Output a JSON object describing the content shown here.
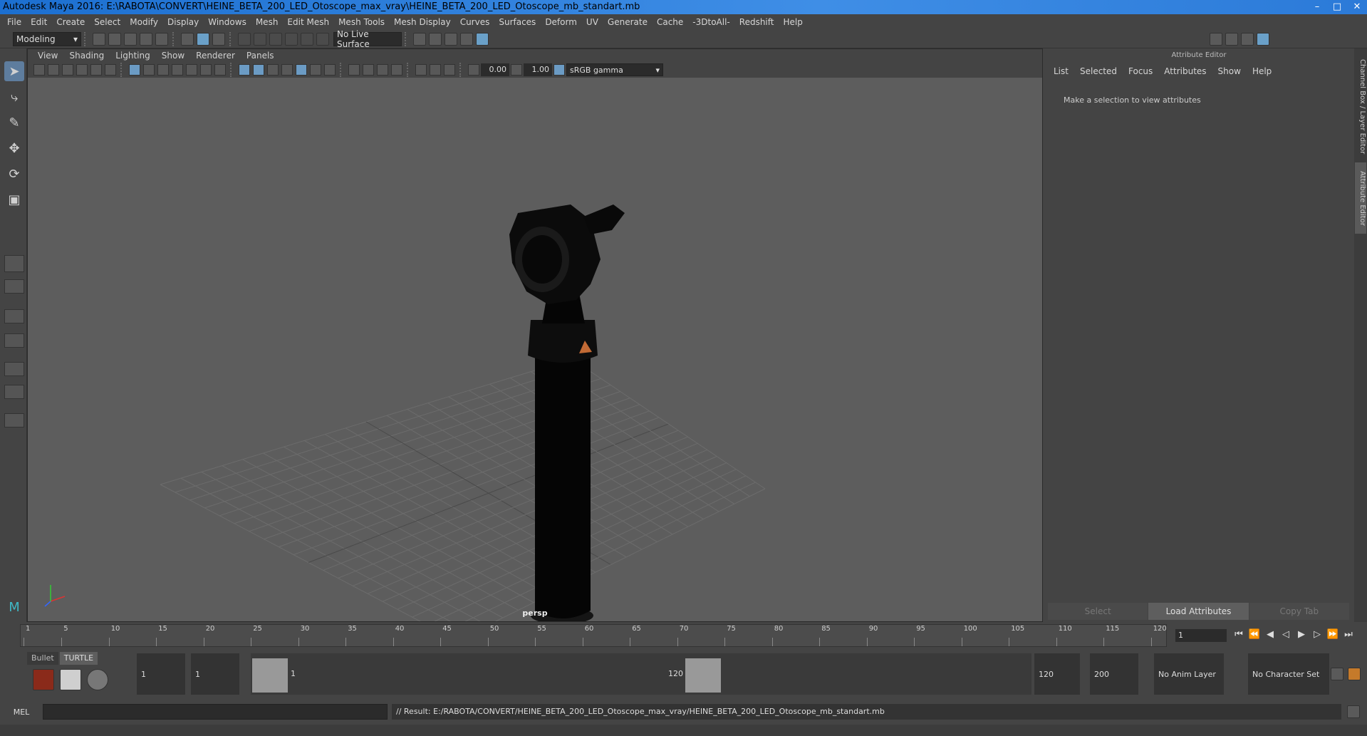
{
  "window": {
    "title": "Autodesk Maya 2016: E:\\RABOTA\\CONVERT\\HEINE_BETA_200_LED_Otoscope_max_vray\\HEINE_BETA_200_LED_Otoscope_mb_standart.mb"
  },
  "menus": [
    "File",
    "Edit",
    "Create",
    "Select",
    "Modify",
    "Display",
    "Windows",
    "Mesh",
    "Edit Mesh",
    "Mesh Tools",
    "Mesh Display",
    "Curves",
    "Surfaces",
    "Deform",
    "UV",
    "Generate",
    "Cache",
    "-3DtoAll-",
    "Redshift",
    "Help"
  ],
  "statusline": {
    "mode": "Modeling",
    "live_surface": "No Live Surface"
  },
  "viewport": {
    "panel_menus": [
      "View",
      "Shading",
      "Lighting",
      "Show",
      "Renderer",
      "Panels"
    ],
    "exposure": "0.00",
    "gamma": "1.00",
    "color_space": "sRGB gamma",
    "camera": "persp"
  },
  "attribute_editor": {
    "title": "Attribute Editor",
    "menus": [
      "List",
      "Selected",
      "Focus",
      "Attributes",
      "Show",
      "Help"
    ],
    "message": "Make a selection to view attributes",
    "buttons": [
      "Select",
      "Load Attributes",
      "Copy Tab"
    ]
  },
  "side_tabs": [
    "Channel Box / Layer Editor",
    "Attribute Editor"
  ],
  "timeline": {
    "ticks": [
      "1",
      "5",
      "10",
      "15",
      "20",
      "25",
      "30",
      "35",
      "40",
      "45",
      "50",
      "55",
      "60",
      "65",
      "70",
      "75",
      "80",
      "85",
      "90",
      "95",
      "100",
      "105",
      "110",
      "115",
      "120"
    ],
    "current_frame": "1"
  },
  "range": {
    "start": "1",
    "playback_start": "1",
    "range_start_label": "1",
    "range_end_label": "120",
    "playback_end": "120",
    "end": "200",
    "anim_layer": "No Anim Layer",
    "character_set": "No Character Set"
  },
  "shelf": {
    "tabs": [
      "Bullet",
      "TURTLE"
    ]
  },
  "command_line": {
    "label": "MEL",
    "result": "// Result: E:/RABOTA/CONVERT/HEINE_BETA_200_LED_Otoscope_max_vray/HEINE_BETA_200_LED_Otoscope_mb_standart.mb"
  }
}
